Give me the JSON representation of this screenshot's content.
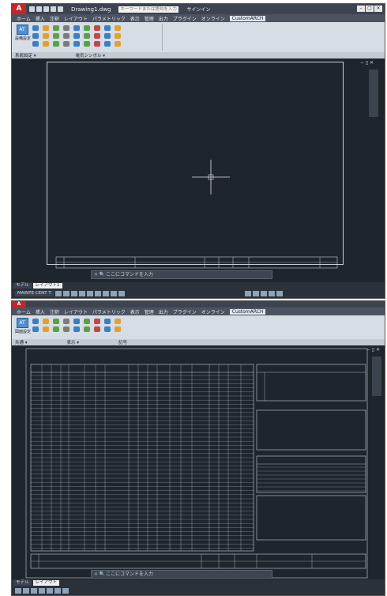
{
  "window1": {
    "app_logo": "A",
    "doc_title": "Drawing1.dwg",
    "search_placeholder": "キーワードまたは語句を入力",
    "signin": "サインイン",
    "menu_tabs": [
      "ホーム",
      "挿入",
      "注釈",
      "レイアウト",
      "パラメトリック",
      "表示",
      "管理",
      "出力",
      "プラグイン",
      "オンライン",
      "CustomARCH"
    ],
    "active_tab": "CustomARCH",
    "big_button_label": "設備設定",
    "panel_labels": [
      "系統設定 ▾",
      "電気シンボル ▾"
    ],
    "command_placeholder": "ここにコマンドを入力",
    "layout_tabs": [
      "モデル",
      "レイアウト1"
    ],
    "status_left": "MAINTE CENT T",
    "viewport_controls": "− ▯ ✕"
  },
  "window2": {
    "big_button_label": "図面設定",
    "menu_tabs": [
      "ホーム",
      "挿入",
      "注釈",
      "レイアウト",
      "パラメトリック",
      "表示",
      "管理",
      "出力",
      "プラグイン",
      "オンライン",
      "CustomARCH"
    ],
    "active_tab": "CustomARCH",
    "panel_labels": [
      "共通 ▾",
      "表示 ▾",
      "記号"
    ],
    "command_placeholder": "ここにコマンドを入力",
    "layout_tabs": [
      "モデル",
      "レイアウト"
    ],
    "viewport_controls": "− ▯ ✕"
  },
  "colors": {
    "canvas": "#1f252d",
    "ribbon": "#d7dde4",
    "line": "#c9cfd6",
    "accent": "#c0262b"
  },
  "icons": [
    "autocad-logo-icon",
    "save-icon",
    "open-icon",
    "undo-icon",
    "redo-icon",
    "crosshair-cursor-icon",
    "viewcube-icon"
  ]
}
